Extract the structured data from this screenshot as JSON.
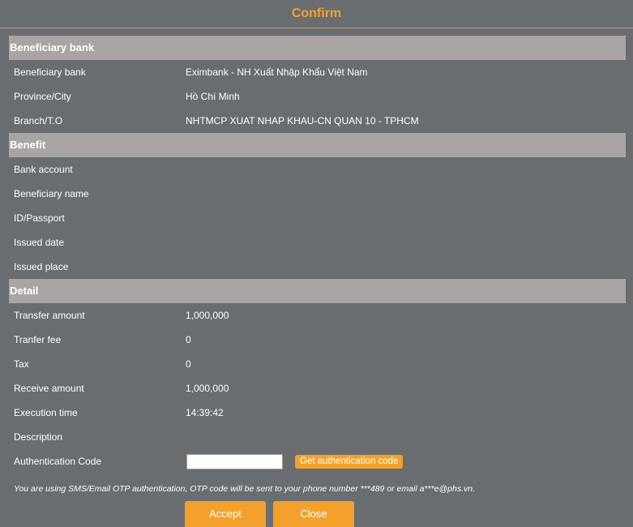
{
  "dialog": {
    "title": "Confirm"
  },
  "sections": {
    "beneficiary_bank": {
      "header": "Beneficiary bank",
      "rows": [
        {
          "label": "Beneficiary bank",
          "value": "Eximbank - NH Xuất Nhập Khẩu Việt Nam"
        },
        {
          "label": "Province/City",
          "value": "Hồ Chí Minh"
        },
        {
          "label": "Branch/T.O",
          "value": "NHTMCP XUAT NHAP KHAU-CN QUAN 10 - TPHCM"
        }
      ]
    },
    "benefit": {
      "header": "Benefit",
      "rows": [
        {
          "label": "Bank account",
          "value": ""
        },
        {
          "label": "Beneficiary name",
          "value": ""
        },
        {
          "label": "ID/Passport",
          "value": ""
        },
        {
          "label": "Issued date",
          "value": ""
        },
        {
          "label": "Issued place",
          "value": ""
        }
      ]
    },
    "detail": {
      "header": "Detail",
      "rows": [
        {
          "label": "Transfer amount",
          "value": "1,000,000"
        },
        {
          "label": "Tranfer fee",
          "value": "0"
        },
        {
          "label": "Tax",
          "value": "0"
        },
        {
          "label": "Receive amount",
          "value": "1,000,000"
        },
        {
          "label": "Execution time",
          "value": "14:39:42"
        },
        {
          "label": "Description",
          "value": ""
        }
      ]
    }
  },
  "auth": {
    "label": "Authentication Code",
    "input_value": "",
    "get_code_label": "Get authentication code"
  },
  "note": "You are using SMS/Email OTP authentication, OTP code will be sent to your phone number ***489 or email a***e@phs.vn.",
  "buttons": {
    "accept": "Accept",
    "close": "Close"
  },
  "colors": {
    "background": "#696d70",
    "accent": "#f3a12c",
    "section_header": "#aaa5a5"
  }
}
